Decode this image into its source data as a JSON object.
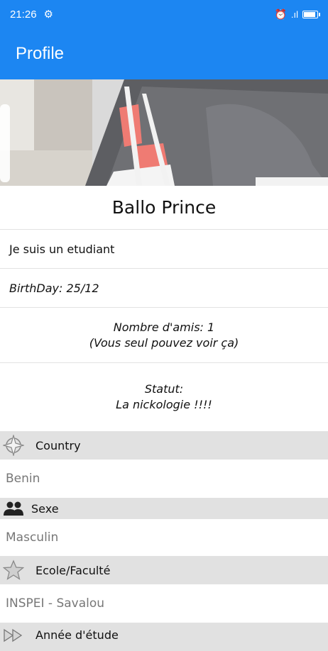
{
  "status_bar": {
    "time": "21:26",
    "gear_icon": "gear-icon",
    "alarm_icon": "alarm-icon",
    "signal_text": ".ıl"
  },
  "app_bar": {
    "title": "Profile"
  },
  "profile": {
    "name": "Ballo Prince",
    "bio": "Je suis un etudiant",
    "birthday": "BirthDay: 25/12",
    "friends_line1": "Nombre d'amis: 1",
    "friends_line2": "(Vous seul pouvez voir ça)",
    "status_label": "Statut:",
    "status_value": "La nickologie !!!!"
  },
  "sections": {
    "country": {
      "label": "Country",
      "value": "Benin",
      "icon": "compass-icon"
    },
    "sexe": {
      "label": "Sexe",
      "value": "Masculin",
      "icon": "people-icon"
    },
    "ecole": {
      "label": "Ecole/Faculté",
      "value": "INSPEI - Savalou",
      "icon": "star-icon"
    },
    "annee": {
      "label": "Année d'étude",
      "icon": "fast-forward-icon"
    }
  },
  "colors": {
    "primary": "#1c86f2",
    "section_bg": "#e1e1e1"
  }
}
